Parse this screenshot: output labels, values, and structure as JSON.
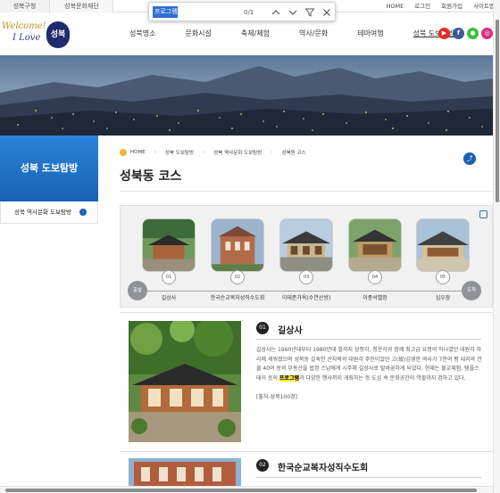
{
  "topbar": {
    "tabs": [
      "성북구청",
      "성북문화재단"
    ],
    "links": [
      "HOME",
      "로그인",
      "회원가입",
      "사이트맵"
    ]
  },
  "find": {
    "query": "프로그램",
    "count": "0/1"
  },
  "logo": {
    "line1": "Welcome!",
    "line2": "I Love",
    "mark": "성북"
  },
  "nav": [
    "성북명소",
    "문화시설",
    "축제/체험",
    "역사/문화",
    "테마여행",
    "성북 도보탐방"
  ],
  "social": [
    {
      "name": "youtube-icon",
      "glyph": "▶",
      "color": "#e52d27"
    },
    {
      "name": "facebook-icon",
      "glyph": "f",
      "color": "#3b5998"
    },
    {
      "name": "kakao-icon",
      "glyph": "●",
      "color": "#3bbf3b"
    },
    {
      "name": "instagram-icon",
      "glyph": "◎",
      "color": "#d6307d"
    }
  ],
  "sidebar": {
    "title": "성북 도보탐방",
    "items": [
      {
        "label": "성북 역사문화 도보탐방"
      }
    ]
  },
  "breadcrumb": [
    "HOME",
    "성북 도보탐방",
    "성북 역사문화 도보탐방",
    "성북동 코스"
  ],
  "page": {
    "title": "성북동 코스"
  },
  "course": {
    "start": "출발",
    "end": "도착",
    "stops": [
      {
        "num": "01",
        "name": "길상사"
      },
      {
        "num": "02",
        "name": "한국순교복자성직수도회"
      },
      {
        "num": "03",
        "name": "이태준가옥(수연산방)"
      },
      {
        "num": "04",
        "name": "이종석별장"
      },
      {
        "num": "05",
        "name": "심우장"
      }
    ]
  },
  "spots": [
    {
      "num": "01",
      "name": "길상사",
      "desc_before": "길상사는 1960년대부터 1980년대 말까지 삼청각, 청운각과 함께 최고급 요정의 하나였던 대원각 자리에 세워졌으며 성북동 길숙한 산자락의 대원각 주인이었던 고(故)김영한 여사가 7천여 평 대지와 건물 40여 동의 부동산을 법정 스님에게 시주해 길상사로 탈바꿈하게 되었다. 현재는 불교체험, 템플스테이 등의 ",
      "desc_highlight": "프로그램",
      "desc_after": "과 다양한 행사까지 개최하는 등 도심 속 문화공간의 역할까지 겸하고 있다.",
      "ref": "[출처-성북100경]"
    },
    {
      "num": "02",
      "name": "한국순교복자성직수도회"
    }
  ]
}
